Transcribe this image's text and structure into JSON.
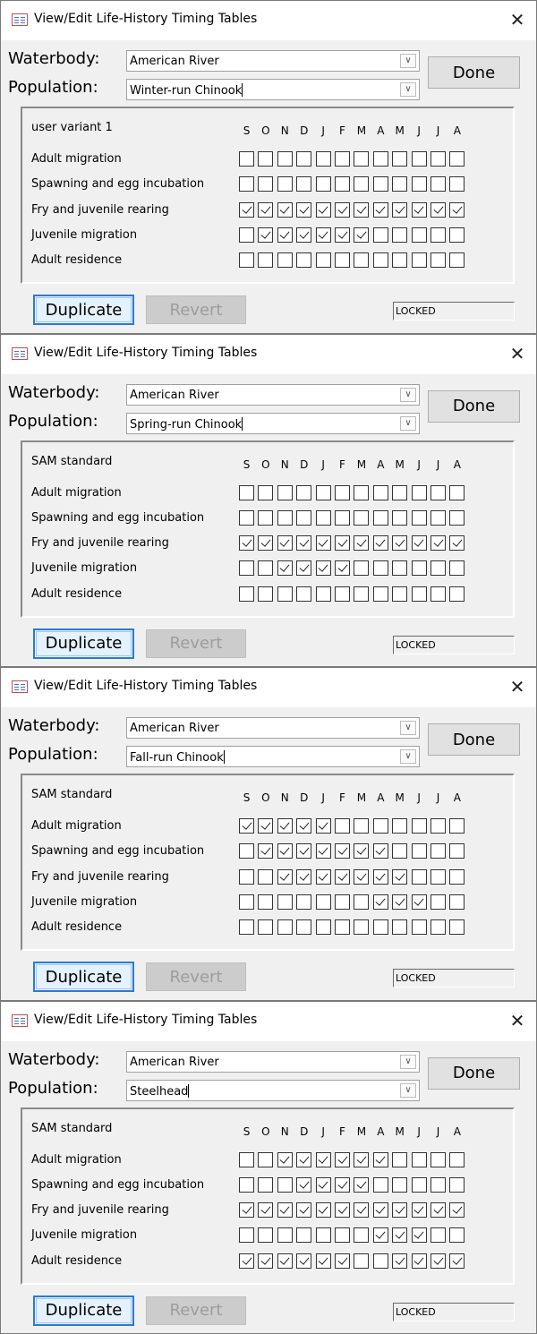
{
  "title": "View/Edit Life-History Timing Tables",
  "waterbody_label": "Waterbody:",
  "population_label": "Population:",
  "done_label": "Done",
  "duplicate_label": "Duplicate",
  "revert_label": "Revert",
  "status_text": "LOCKED",
  "months": [
    "S",
    "O",
    "N",
    "D",
    "J",
    "F",
    "M",
    "A",
    "M",
    "J",
    "J",
    "A"
  ],
  "stages": [
    "Adult migration",
    "Spawning and egg incubation",
    "Fry and juvenile rearing",
    "Juvenile migration",
    "Adult residence"
  ],
  "windows": [
    {
      "waterbody": "American River",
      "population": "Winter-run Chinook",
      "variant": "user variant 1",
      "checks": [
        [
          0,
          0,
          0,
          0,
          0,
          0,
          0,
          0,
          0,
          0,
          0,
          0
        ],
        [
          0,
          0,
          0,
          0,
          0,
          0,
          0,
          0,
          0,
          0,
          0,
          0
        ],
        [
          1,
          1,
          1,
          1,
          1,
          1,
          1,
          1,
          1,
          1,
          1,
          1
        ],
        [
          0,
          1,
          1,
          1,
          1,
          1,
          1,
          0,
          0,
          0,
          0,
          0
        ],
        [
          0,
          0,
          0,
          0,
          0,
          0,
          0,
          0,
          0,
          0,
          0,
          0
        ]
      ]
    },
    {
      "waterbody": "American River",
      "population": "Spring-run Chinook",
      "variant": "SAM standard",
      "checks": [
        [
          0,
          0,
          0,
          0,
          0,
          0,
          0,
          0,
          0,
          0,
          0,
          0
        ],
        [
          0,
          0,
          0,
          0,
          0,
          0,
          0,
          0,
          0,
          0,
          0,
          0
        ],
        [
          1,
          1,
          1,
          1,
          1,
          1,
          1,
          1,
          1,
          1,
          1,
          1
        ],
        [
          0,
          0,
          1,
          1,
          1,
          1,
          0,
          0,
          0,
          0,
          0,
          0
        ],
        [
          0,
          0,
          0,
          0,
          0,
          0,
          0,
          0,
          0,
          0,
          0,
          0
        ]
      ]
    },
    {
      "waterbody": "American River",
      "population": "Fall-run Chinook",
      "variant": "SAM standard",
      "checks": [
        [
          1,
          1,
          1,
          1,
          1,
          0,
          0,
          0,
          0,
          0,
          0,
          0
        ],
        [
          0,
          1,
          1,
          1,
          1,
          1,
          1,
          1,
          0,
          0,
          0,
          0
        ],
        [
          0,
          0,
          1,
          1,
          1,
          1,
          1,
          1,
          1,
          0,
          0,
          0
        ],
        [
          0,
          0,
          0,
          0,
          0,
          0,
          0,
          1,
          1,
          1,
          0,
          0
        ],
        [
          0,
          0,
          0,
          0,
          0,
          0,
          0,
          0,
          0,
          0,
          0,
          0
        ]
      ]
    },
    {
      "waterbody": "American River",
      "population": "Steelhead",
      "variant": "SAM standard",
      "checks": [
        [
          0,
          0,
          1,
          1,
          1,
          1,
          1,
          1,
          0,
          0,
          0,
          0
        ],
        [
          0,
          0,
          0,
          1,
          1,
          1,
          1,
          0,
          0,
          0,
          0,
          0
        ],
        [
          1,
          1,
          1,
          1,
          1,
          1,
          1,
          1,
          1,
          1,
          1,
          1
        ],
        [
          0,
          0,
          0,
          0,
          0,
          0,
          0,
          1,
          1,
          1,
          0,
          0
        ],
        [
          1,
          1,
          1,
          1,
          1,
          1,
          0,
          0,
          1,
          1,
          1,
          1
        ]
      ]
    }
  ]
}
